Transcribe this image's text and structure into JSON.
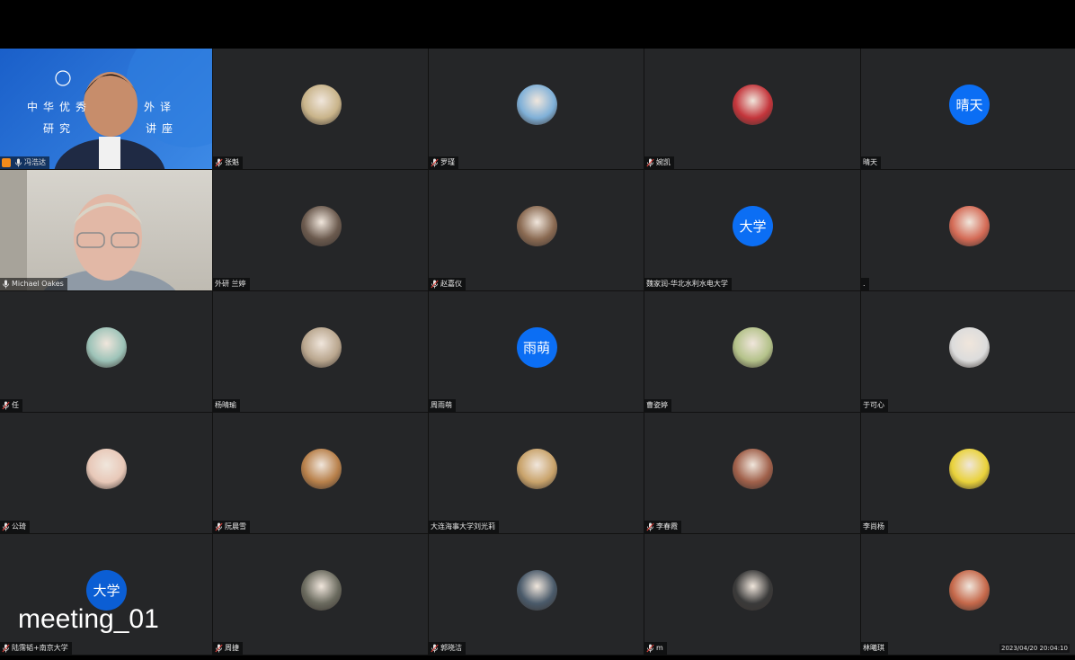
{
  "meeting": {
    "watermark": "meeting_01",
    "timestamp": "2023/04/20 20:04:10",
    "host_banner_line1": "中华优秀",
    "host_banner_line1b": "外译",
    "host_banner_line2": "研究",
    "host_banner_line2b": "讲座"
  },
  "colors": {
    "tile_bg": "#252628",
    "text_avatar_blue": "#0b6ef4",
    "host_badge": "#f28b1c"
  },
  "participants": [
    {
      "name": "冯浩达",
      "muted": false,
      "avatar_text": "",
      "avatar_color": "",
      "video": "host"
    },
    {
      "name": "张魁",
      "muted": true,
      "avatar_text": "",
      "avatar_color": "#c9b48a"
    },
    {
      "name": "罗瑾",
      "muted": true,
      "avatar_text": "",
      "avatar_color": "#7fb0d8"
    },
    {
      "name": "婉凯",
      "muted": true,
      "avatar_text": "",
      "avatar_color": "#c4353b"
    },
    {
      "name": "晴天",
      "muted": false,
      "avatar_text": "晴天",
      "avatar_color": "#0b6ef4"
    },
    {
      "name": "Michael Oakes",
      "muted": false,
      "avatar_text": "",
      "avatar_color": "",
      "video": "guest"
    },
    {
      "name": "外研 兰婷",
      "muted": false,
      "avatar_text": "",
      "avatar_color": "#6b5a4e"
    },
    {
      "name": "赵嘉仪",
      "muted": true,
      "avatar_text": "",
      "avatar_color": "#8a6a52"
    },
    {
      "name": "魏家润-华北水利水电大学",
      "muted": false,
      "avatar_text": "大学",
      "avatar_color": "#0b6ef4"
    },
    {
      "name": ".",
      "muted": false,
      "avatar_text": "",
      "avatar_color": "#d46a55"
    },
    {
      "name": "任",
      "muted": true,
      "avatar_text": "",
      "avatar_color": "#9dc3b8"
    },
    {
      "name": "杨晴瑜",
      "muted": false,
      "avatar_text": "",
      "avatar_color": "#b9a68e"
    },
    {
      "name": "周雨萌",
      "muted": false,
      "avatar_text": "雨萌",
      "avatar_color": "#0b6ef4"
    },
    {
      "name": "曹姿婷",
      "muted": false,
      "avatar_text": "",
      "avatar_color": "#b4c28a"
    },
    {
      "name": "于可心",
      "muted": false,
      "avatar_text": "",
      "avatar_color": "#dcdcdc"
    },
    {
      "name": "公琦",
      "muted": true,
      "avatar_text": "",
      "avatar_color": "#e8c8b8"
    },
    {
      "name": "阮晨雪",
      "muted": true,
      "avatar_text": "",
      "avatar_color": "#b8804a"
    },
    {
      "name": "大连海事大学刘光莉",
      "muted": false,
      "avatar_text": "",
      "avatar_color": "#c9a36b"
    },
    {
      "name": "李春霞",
      "muted": true,
      "avatar_text": "",
      "avatar_color": "#a0604a"
    },
    {
      "name": "李尚杨",
      "muted": false,
      "avatar_text": "",
      "avatar_color": "#e9d23a"
    },
    {
      "name": "陆霈韬+南京大学",
      "muted": true,
      "avatar_text": "大学",
      "avatar_color": "#0b5ed4"
    },
    {
      "name": "周捷",
      "muted": true,
      "avatar_text": "",
      "avatar_color": "#6a6a5e"
    },
    {
      "name": "郭晓洁",
      "muted": true,
      "avatar_text": "",
      "avatar_color": "#4a5a6a"
    },
    {
      "name": "m",
      "muted": true,
      "avatar_text": "",
      "avatar_color": "#3a3a3a"
    },
    {
      "name": "林曦琪",
      "muted": false,
      "avatar_text": "",
      "avatar_color": "#c5684a"
    }
  ]
}
